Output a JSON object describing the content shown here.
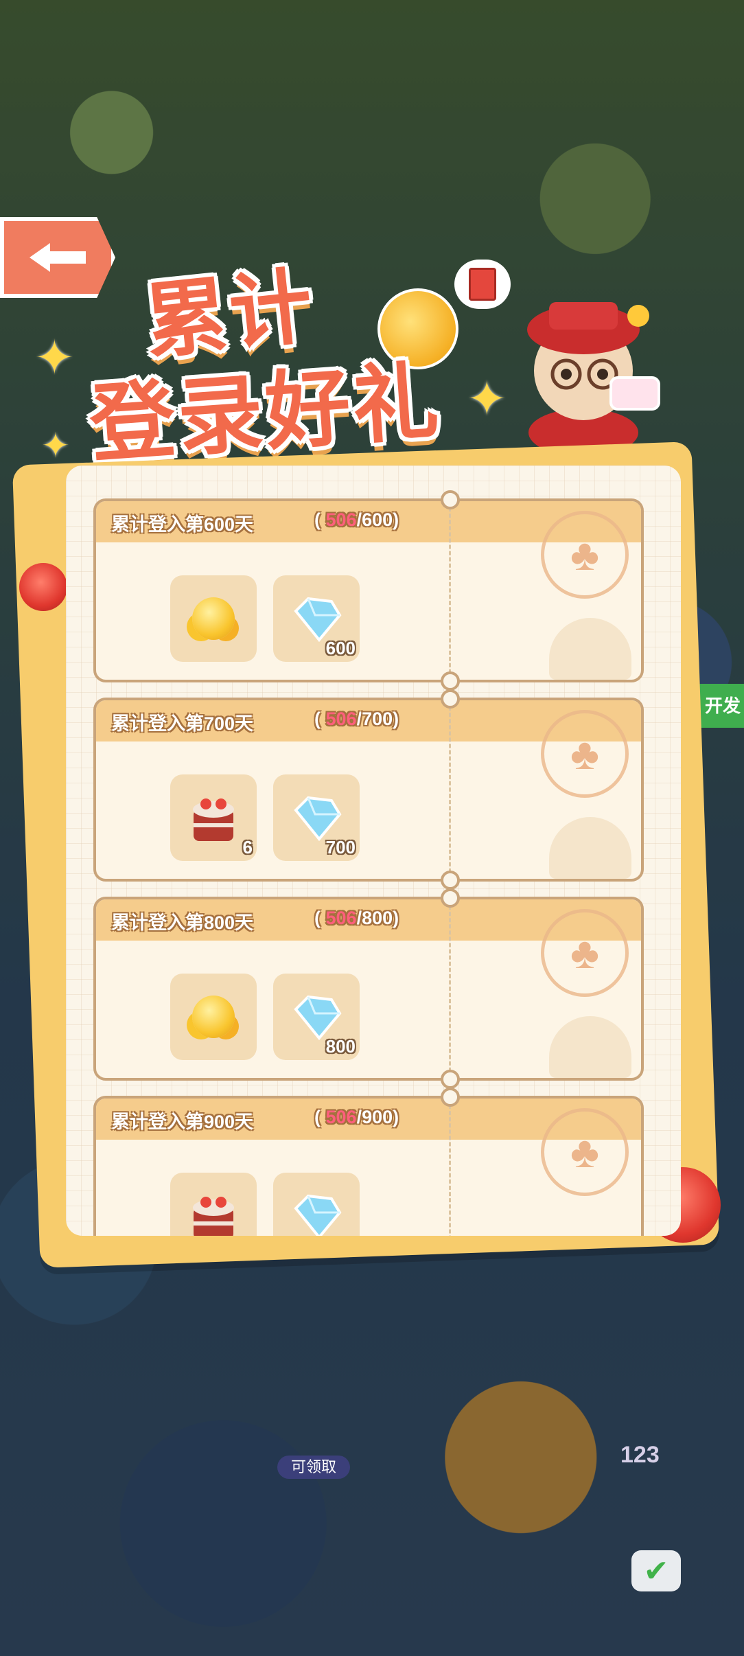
{
  "title": {
    "line1": "累计",
    "line2": "登录好礼"
  },
  "back_button": {
    "icon": "arrow-left-icon"
  },
  "background_labels": {
    "claimable": "可领取",
    "number": "123",
    "side_tab": "开发"
  },
  "rewards": [
    {
      "title": "累计登入第600天",
      "progress_current": "506",
      "progress_target": "600",
      "items": [
        {
          "icon": "gold-coins-icon",
          "count": ""
        },
        {
          "icon": "diamond-icon",
          "count": "600"
        }
      ]
    },
    {
      "title": "累计登入第700天",
      "progress_current": "506",
      "progress_target": "700",
      "items": [
        {
          "icon": "cake-icon",
          "count": "6"
        },
        {
          "icon": "diamond-icon",
          "count": "700"
        }
      ]
    },
    {
      "title": "累计登入第800天",
      "progress_current": "506",
      "progress_target": "800",
      "items": [
        {
          "icon": "gold-coins-icon",
          "count": ""
        },
        {
          "icon": "diamond-icon",
          "count": "800"
        }
      ]
    },
    {
      "title": "累计登入第900天",
      "progress_current": "506",
      "progress_target": "900",
      "items": [
        {
          "icon": "cake-icon",
          "count": ""
        },
        {
          "icon": "diamond-icon",
          "count": ""
        }
      ]
    }
  ],
  "colors": {
    "accent": "#f26a4b",
    "progress_current": "#ff5f7c",
    "panel_border": "#f7cc6c",
    "card_header": "#f5cc8c"
  }
}
